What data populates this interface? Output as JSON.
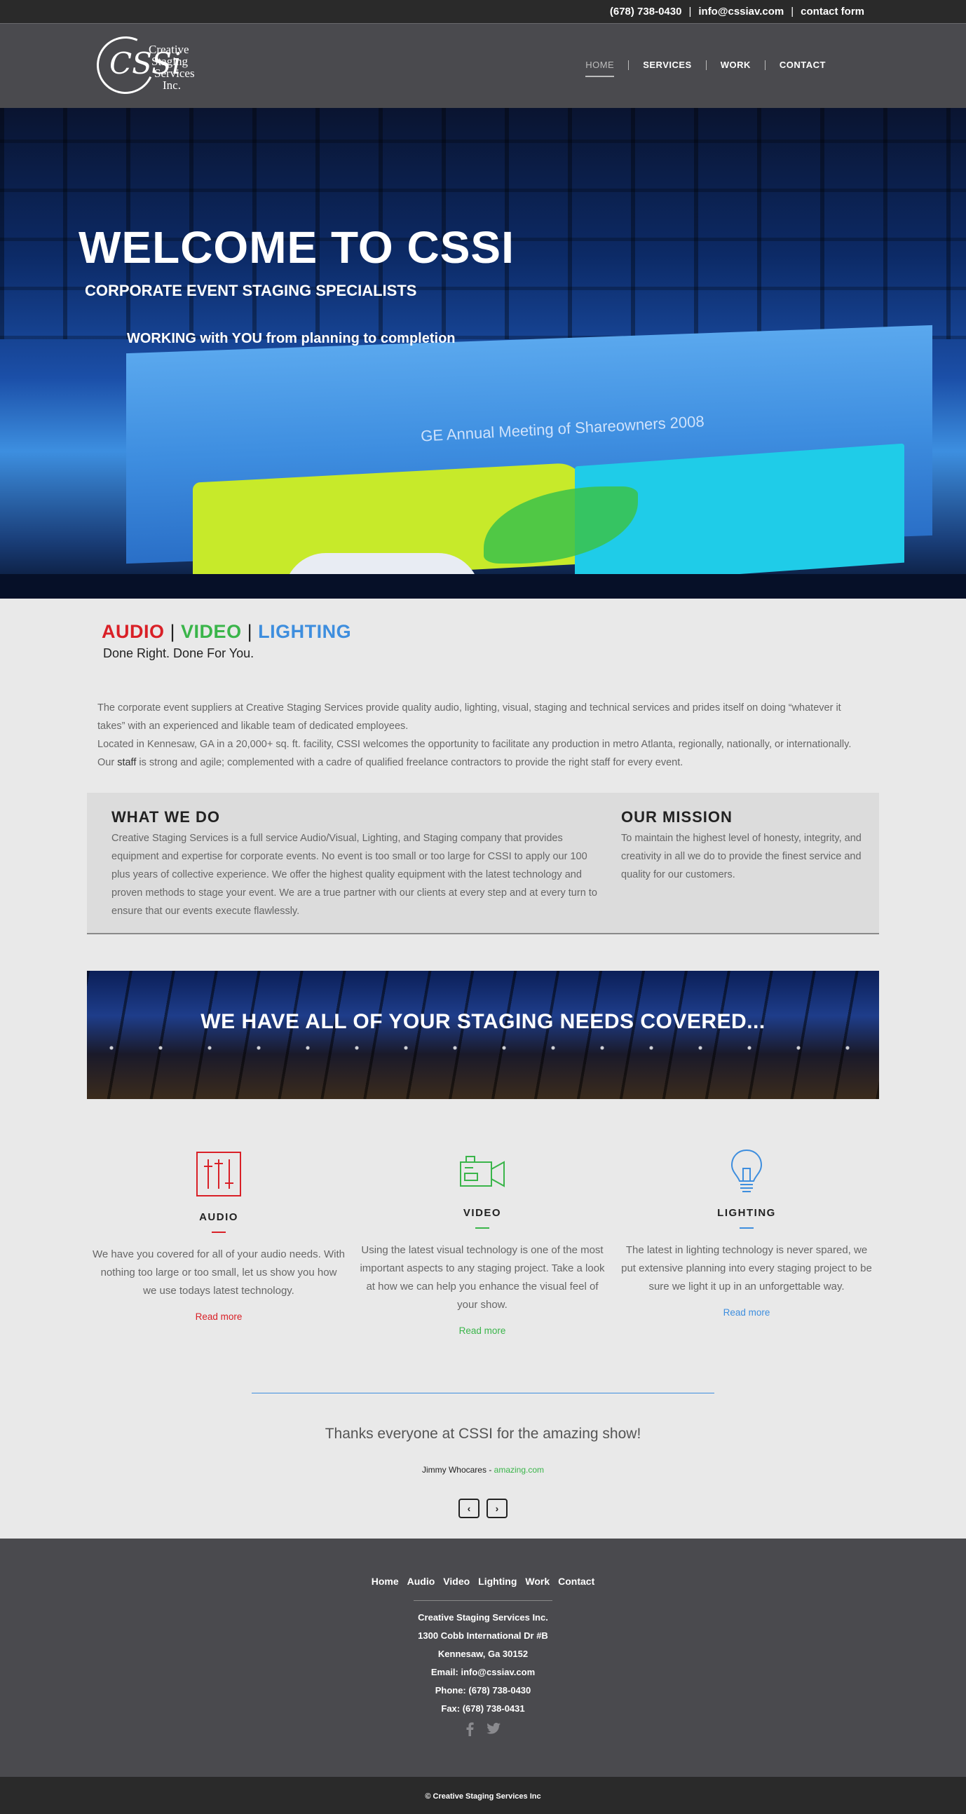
{
  "topbar": {
    "phone": "(678) 738-0430",
    "email": "info@cssiav.com",
    "form_link": "contact form",
    "separator": "|"
  },
  "logo": {
    "monogram": "CSSi",
    "lines": [
      "Creative",
      "Staging",
      "Services",
      "Inc."
    ]
  },
  "nav": {
    "items": [
      {
        "label": "HOME",
        "active": true
      },
      {
        "label": "SERVICES",
        "active": false
      },
      {
        "label": "WORK",
        "active": false
      },
      {
        "label": "CONTACT",
        "active": false
      }
    ]
  },
  "hero": {
    "title": "WELCOME TO CSSI",
    "subtitle": "CORPORATE EVENT STAGING SPECIALISTS",
    "tagline": "WORKING with YOU from planning to completion",
    "screen_text": "GE Annual Meeting of Shareowners 2008"
  },
  "services_line": {
    "audio": "AUDIO",
    "video": "VIDEO",
    "lighting": "LIGHTING",
    "bar": "|",
    "tagline": "Done Right. Done For You."
  },
  "intro": {
    "p1": "The corporate event suppliers at Creative Staging Services provide quality audio, lighting, visual, staging and technical services and prides itself on doing “whatever it takes” with an experienced and likable team of dedicated employees.",
    "p2_before": "Located in Kennesaw, GA in a 20,000+ sq. ft. facility, CSSI welcomes the opportunity to facilitate any production in metro Atlanta, regionally, nationally, or internationally. Our ",
    "p2_link": "staff",
    "p2_after": " is strong and agile; complemented with a cadre of qualified freelance contractors to provide the right staff for every event."
  },
  "what_we_do": {
    "heading": "WHAT WE DO",
    "text": "Creative Staging Services is a full service Audio/Visual, Lighting, and Staging company that provides equipment and expertise for corporate events.  No event is too small or too large for CSSI to apply our 100 plus years of collective experience.  We offer the highest quality equipment with the latest technology and proven methods to stage your event.  We are a true partner with our clients at every step and at every turn to ensure that our events execute flawlessly."
  },
  "mission": {
    "heading": "OUR MISSION",
    "text": "To maintain the highest level of honesty, integrity, and creativity in all we do to provide the finest service and quality for our customers."
  },
  "banner": {
    "text": "WE HAVE ALL OF YOUR STAGING NEEDS COVERED..."
  },
  "features": {
    "audio": {
      "title": "AUDIO",
      "text": "We have you covered for all of your audio needs. With nothing too large or too small, let us show you how we use todays latest technology.",
      "more": "Read more",
      "color": "#d92027",
      "icon": "mixer-sliders-icon"
    },
    "video": {
      "title": "VIDEO",
      "text": "Using the latest visual technology is one of the most important aspects to any staging project. Take a look at how we can help you enhance the visual feel of your show.",
      "more": "Read more",
      "color": "#3ab54a",
      "icon": "video-camera-icon"
    },
    "lighting": {
      "title": "LIGHTING",
      "text": "The latest in lighting technology is never spared, we put extensive planning into every staging project to be sure we light it up in an unforgettable way.",
      "more": "Read more",
      "color": "#3e8ede",
      "icon": "light-bulb-icon"
    }
  },
  "testimonial": {
    "quote": "Thanks everyone at CSSI for the amazing show!",
    "author": "Jimmy Whocares - ",
    "site": "amazing.com",
    "prev": "‹",
    "next": "›"
  },
  "footer": {
    "nav": [
      "Home",
      "Audio",
      "Video",
      "Lighting",
      "Work",
      "Contact"
    ],
    "address": [
      "Creative Staging Services Inc.",
      "1300 Cobb International Dr #B",
      "Kennesaw, Ga 30152",
      "Email: info@cssiav.com",
      "Phone: (678) 738-0430",
      "Fax: (678) 738-0431"
    ],
    "copyright": "© Creative Staging Services Inc"
  }
}
